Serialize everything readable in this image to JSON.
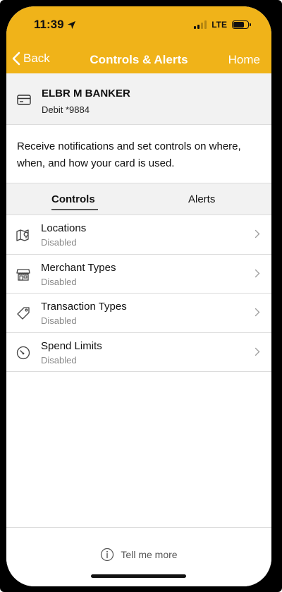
{
  "status_bar": {
    "time": "11:39",
    "network": "LTE"
  },
  "nav": {
    "back_label": "Back",
    "title": "Controls & Alerts",
    "home_label": "Home"
  },
  "card": {
    "name": "ELBR M BANKER",
    "number": "Debit *9884"
  },
  "description": "Receive notifications and set controls on where, when, and how your card is used.",
  "tabs": [
    {
      "label": "Controls",
      "selected": true
    },
    {
      "label": "Alerts",
      "selected": false
    }
  ],
  "controls": [
    {
      "label": "Locations",
      "status": "Disabled",
      "icon": "map-location-icon"
    },
    {
      "label": "Merchant Types",
      "status": "Disabled",
      "icon": "storefront-icon"
    },
    {
      "label": "Transaction Types",
      "status": "Disabled",
      "icon": "tag-icon"
    },
    {
      "label": "Spend Limits",
      "status": "Disabled",
      "icon": "gauge-icon"
    }
  ],
  "footer": {
    "tell_more_label": "Tell me more"
  },
  "colors": {
    "header": "#f0b319",
    "strip": "#f2f2f2",
    "divider": "#dcdcdc",
    "subtext": "#8a8a8a"
  }
}
